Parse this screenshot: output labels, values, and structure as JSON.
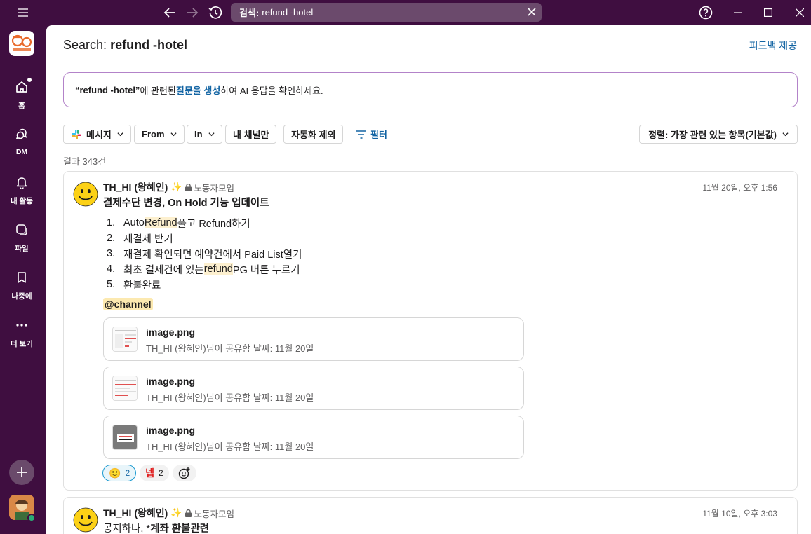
{
  "titlebar": {
    "search_label": "검색:",
    "search_query": "refund -hotel"
  },
  "rail": {
    "items": [
      {
        "label": "홈"
      },
      {
        "label": "DM"
      },
      {
        "label": "내 활동"
      },
      {
        "label": "파일"
      },
      {
        "label": "나중에"
      },
      {
        "label": "더 보기"
      }
    ]
  },
  "header": {
    "title_prefix": "Search:",
    "title_query": "refund -hotel",
    "feedback": "피드백 제공"
  },
  "ai_prompt": {
    "query": "“refund -hotel”",
    "part1": "에 관련된 ",
    "link": "질문을 생성",
    "part2": "하여 AI 응답을 확인하세요."
  },
  "filters": {
    "messages": "메시지",
    "from": "From",
    "in": "In",
    "my_channels": "내 채널만",
    "exclude_auto": "자동화 제외",
    "filter": "필터",
    "sort": "정렬: 가장 관련 있는 항목(기본값)"
  },
  "results": {
    "count": "결과 343건"
  },
  "messages": [
    {
      "author": "TH_HI (왕혜인)",
      "channel": "노동자모임",
      "time": "11월 20일, 오후 1:56",
      "title": "결제수단 변경, On Hold 기능 업데이트",
      "list": [
        {
          "n": "1.",
          "a": "Auto ",
          "h": "Refund",
          "b": " 풀고 Refund하기"
        },
        {
          "n": "2.",
          "a": "재결제 받기",
          "h": "",
          "b": ""
        },
        {
          "n": "3.",
          "a": "재결제 확인되면 예약건에서 Paid List열기",
          "h": "",
          "b": ""
        },
        {
          "n": "4.",
          "a": "최초 결제건에 있는 ",
          "h": "refund",
          "b": " PG 버튼 누르기"
        },
        {
          "n": "5.",
          "a": "환불완료",
          "h": "",
          "b": ""
        }
      ],
      "mention": "@channel",
      "files": [
        {
          "name": "image.png",
          "sub": "TH_HI (왕혜인)님이 공유함 날짜: 11월 20일"
        },
        {
          "name": "image.png",
          "sub": "TH_HI (왕혜인)님이 공유함 날짜: 11월 20일"
        },
        {
          "name": "image.png",
          "sub": "TH_HI (왕혜인)님이 공유함 날짜: 11월 20일"
        }
      ],
      "reactions": [
        {
          "count": "2"
        },
        {
          "label": "넵",
          "count": "2"
        }
      ]
    },
    {
      "author": "TH_HI (왕혜인)",
      "channel": "노동자모임",
      "time": "11월 10일, 오후 3:03",
      "title_plain": "공지하나, *",
      "title_bold": "계좌 환불관련"
    }
  ]
}
